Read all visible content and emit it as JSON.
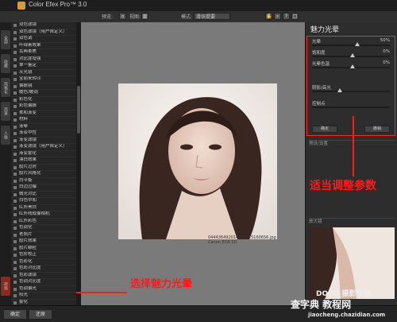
{
  "app": {
    "title": "Color Efex Pro™ 3.0"
  },
  "toolbar": {
    "preview_label": "预览:",
    "view_label": "视图:",
    "mode_label": "模式:",
    "mode_value": "滑块提要"
  },
  "sidebar": {
    "vertical_tabs": [
      "全部",
      "收藏",
      "风格化",
      "风景",
      "人像",
      "转换"
    ],
    "filters": [
      "双色滤镜",
      "双色滤镜（用户自定义）",
      "双色调",
      "叶绿素效果",
      "古典柔焦",
      "对比度增强",
      "单一鉴定",
      "灰光镜",
      "宝丽来转印",
      "偏振镜",
      "暖色/暖调",
      "彩色化",
      "彩色偏振",
      "柔和渐变",
      "材料",
      "渐晕",
      "渐变中性",
      "渐变滤镜",
      "渐变滤镜（用户自定义）",
      "渐变雾化",
      "漂白效果",
      "胶片过时",
      "胶片风格化",
      "白平衡",
      "白边过曝",
      "微光对比",
      "白色中和",
      "红外黑白",
      "红外线成像相机",
      "红外彩色",
      "色调化",
      "老照片",
      "胶片效果",
      "胶片颗粒",
      "色阶校正",
      "色彩化",
      "色彩对比度",
      "色彩滤镜",
      "色调对比度",
      "色调偏光",
      "阳光",
      "雾化",
      "魅力光晕",
      "魅力光晕",
      "黑白转换"
    ],
    "selected_index": 43
  },
  "preview": {
    "caption_line1": "044436492014022215160656.jpg",
    "caption_line2": "Canon EOS 5D"
  },
  "panel": {
    "header_small": "滤镜",
    "title": "魅力光晕",
    "params": [
      {
        "label": "光晕",
        "value": "50%",
        "pos": 0.55
      },
      {
        "label": "饱和度",
        "value": "0%",
        "pos": 0.5
      },
      {
        "label": "光晕色温",
        "value": "0%",
        "pos": 0.5
      },
      {
        "label": "阴影/高光",
        "value": "",
        "pos": 0.35
      },
      {
        "label": "控制点",
        "value": "",
        "pos": 0.5
      }
    ],
    "btn_left": "确定",
    "btn_right": "撤销",
    "section_presets": "预设/设置",
    "section_loupe": "放大镜"
  },
  "bottom": {
    "btn_ok": "确定",
    "btn_reset": "还原",
    "watermark1": "DOCO 摄影专题",
    "watermark2": "查字典 教程网",
    "watermark3": "jiaocheng.chazidian.com"
  },
  "annotations": {
    "adjust": "适当调整参数",
    "select": "选择魅力光晕"
  },
  "colors": {
    "annotation": "#ff1a1a",
    "selected_bg": "#5b1c14"
  }
}
